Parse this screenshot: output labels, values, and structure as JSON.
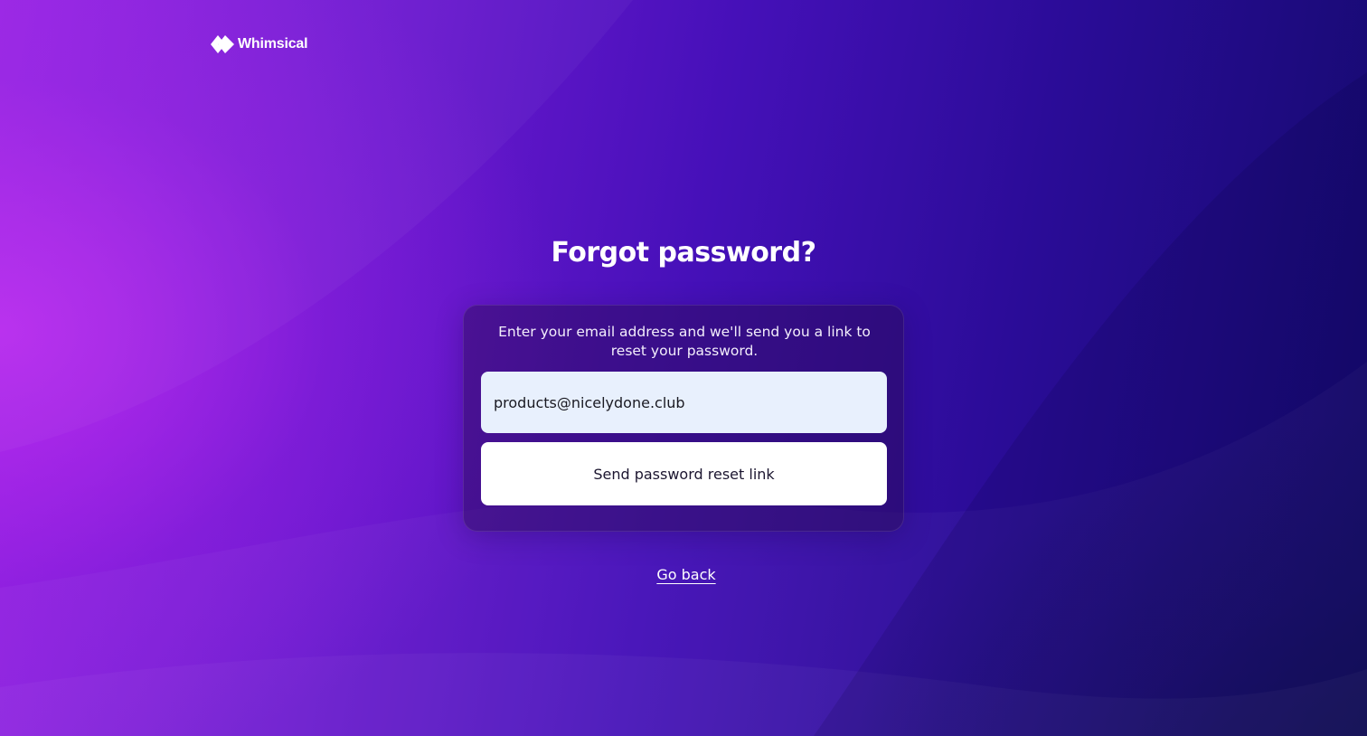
{
  "brand": {
    "name": "Whimsical",
    "logo_icon": "whimsical-diamond-logo-icon"
  },
  "page": {
    "title": "Forgot password?"
  },
  "form": {
    "description": "Enter your email address and we'll send you a link to reset your password.",
    "email_value": "products@nicelydone.club",
    "email_placeholder": "",
    "submit_label": "Send password reset link"
  },
  "footer": {
    "go_back_label": "Go back"
  },
  "colors": {
    "background_left": "#9a22e6",
    "background_right": "#130a6b",
    "input_background": "#e8f0fd",
    "button_background": "#ffffff",
    "text_primary": "#ffffff"
  }
}
